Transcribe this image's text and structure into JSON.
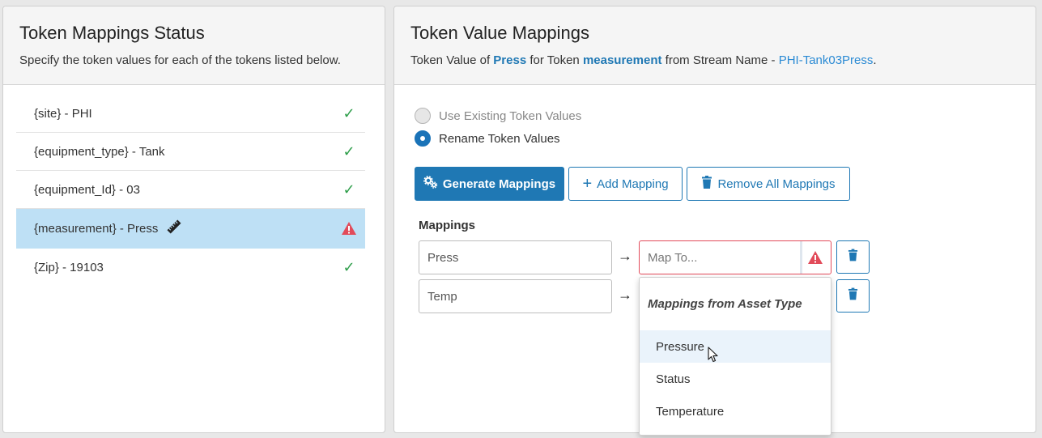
{
  "left": {
    "title": "Token Mappings Status",
    "subtitle": "Specify the token values for each of the tokens listed below.",
    "tokens": [
      {
        "label": "{site} - PHI",
        "status": "ok"
      },
      {
        "label": "{equipment_type} - Tank",
        "status": "ok"
      },
      {
        "label": "{equipment_Id} - 03",
        "status": "ok"
      },
      {
        "label": "{measurement} - Press",
        "status": "warning",
        "selected": true,
        "icon": "ruler-icon"
      },
      {
        "label": "{Zip} - 19103",
        "status": "ok"
      }
    ]
  },
  "right": {
    "title": "Token Value Mappings",
    "subtitle": {
      "part1": "Token Value of ",
      "value": "Press",
      "part2": " for Token ",
      "token": "measurement",
      "part3": " from Stream Name - ",
      "stream": "PHI-Tank03Press",
      "part4": "."
    },
    "radios": {
      "existing": "Use Existing Token Values",
      "rename": "Rename Token Values",
      "selected": "rename"
    },
    "buttons": {
      "generate": "Generate Mappings",
      "add": "Add Mapping",
      "remove_all": "Remove All Mappings"
    },
    "mappings_label": "Mappings",
    "mappings": [
      {
        "from": "Press",
        "to_placeholder": "Map To..."
      },
      {
        "from": "Temp",
        "to_placeholder": ""
      }
    ],
    "dropdown": {
      "group": "Mappings from Asset Type",
      "options": [
        "Pressure",
        "Status",
        "Temperature"
      ],
      "hovered": "Pressure"
    }
  },
  "colors": {
    "primary": "#1f78b4",
    "selected_row": "#bee0f5",
    "ok": "#2e9e4a",
    "warning": "#e24b5a"
  }
}
